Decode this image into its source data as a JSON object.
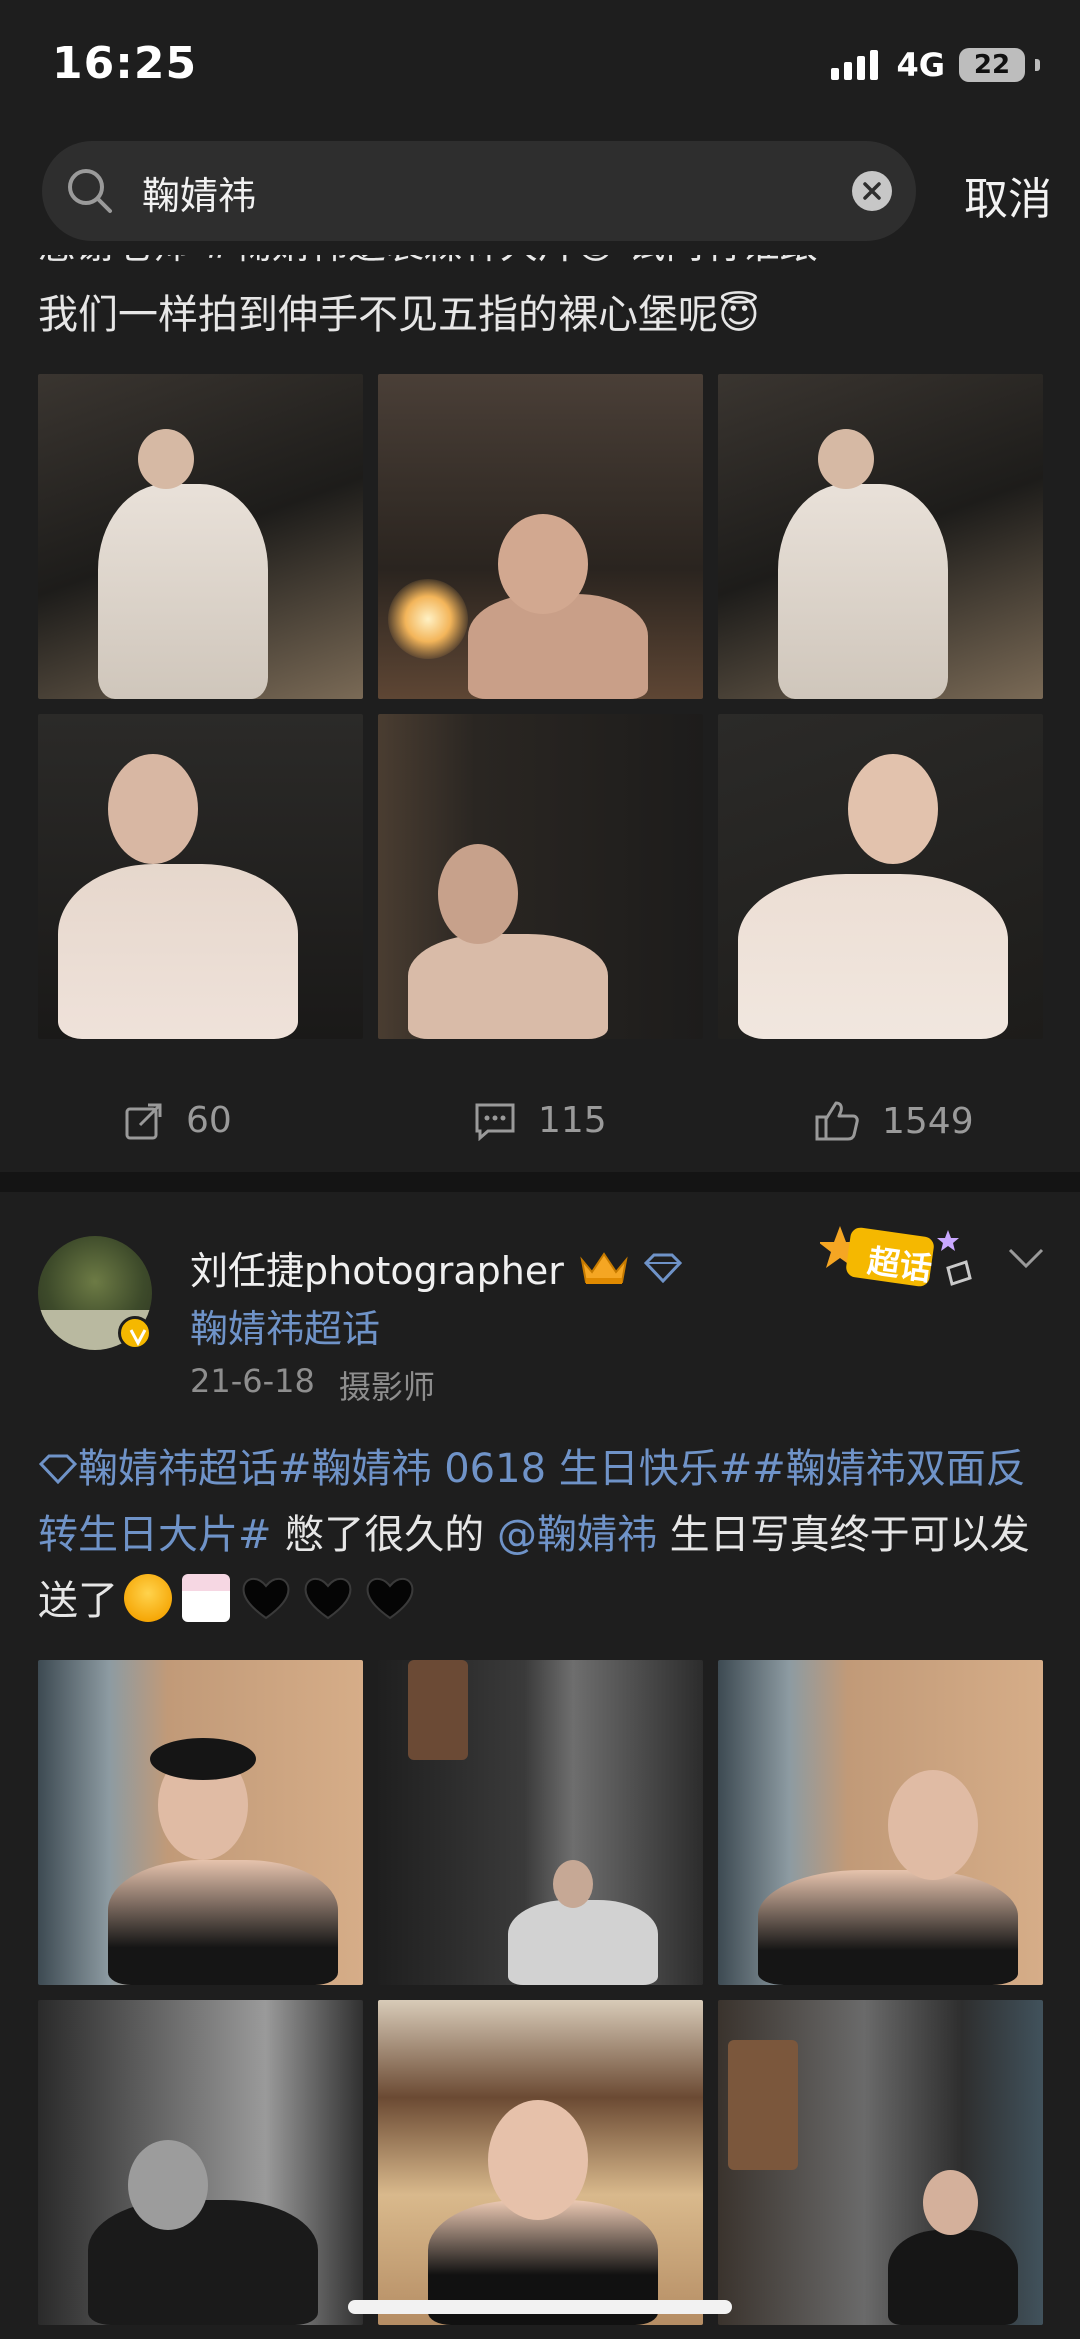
{
  "status": {
    "time": "16:25",
    "network": "4G",
    "battery": "22"
  },
  "search": {
    "query": "鞠婧祎",
    "cancel_label": "取消"
  },
  "post1": {
    "text_cut_line": "感谢老师 #鞠婧祎逆袭森林大片😄 试问有谁跟",
    "text_line": "我们一样拍到伸手不见五指的裸心堡呢😇",
    "repost_count": "60",
    "comment_count": "115",
    "like_count": "1549"
  },
  "post2": {
    "author_name": "刘任捷photographer",
    "topic": "鞠婧祎超话",
    "date": "21-6-18",
    "source": "摄影师",
    "supertalk_label": "超话",
    "text_tag1": "鞠婧祎超话",
    "text_tag2": "#鞠婧祎 0618 生日快乐#",
    "text_tag3": "#鞠婧祎双面反转生日大片#",
    "text_plain1": " 憋了很久的 ",
    "text_mention": "@鞠婧祎",
    "text_plain2": " 生日写真终于可以发送了"
  },
  "colors": {
    "background": "#1e1e1e",
    "link": "#6f93c8",
    "muted": "#8e8e8e",
    "badge": "#f5b800"
  }
}
